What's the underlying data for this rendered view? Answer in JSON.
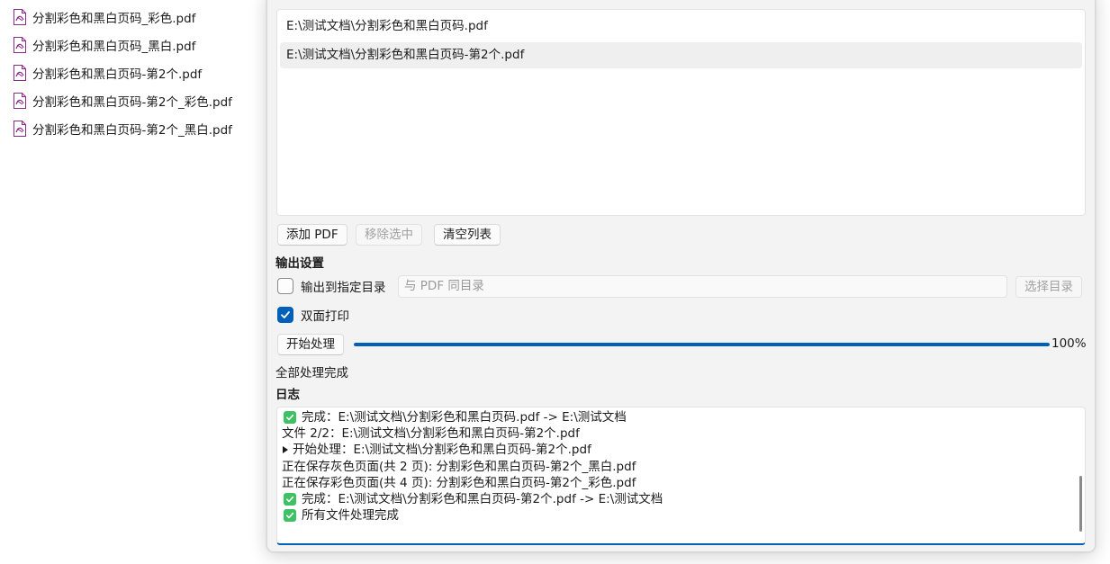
{
  "desktop_files": [
    {
      "name": "分割彩色和黑白页码_彩色.pdf",
      "icon": "pdf-file-icon"
    },
    {
      "name": "分割彩色和黑白页码_黑白.pdf",
      "icon": "pdf-file-icon"
    },
    {
      "name": "分割彩色和黑白页码-第2个.pdf",
      "icon": "pdf-file-icon"
    },
    {
      "name": "分割彩色和黑白页码-第2个_彩色.pdf",
      "icon": "pdf-file-icon"
    },
    {
      "name": "分割彩色和黑白页码-第2个_黑白.pdf",
      "icon": "pdf-file-icon"
    }
  ],
  "pdf_list": {
    "items": [
      {
        "path": "E:\\测试文档\\分割彩色和黑白页码.pdf",
        "selected": false
      },
      {
        "path": "E:\\测试文档\\分割彩色和黑白页码-第2个.pdf",
        "selected": true
      }
    ]
  },
  "list_buttons": {
    "add": "添加 PDF",
    "remove": "移除选中",
    "clear": "清空列表"
  },
  "output_settings": {
    "title": "输出设置",
    "custom_dir_label": "输出到指定目录",
    "custom_dir_checked": false,
    "dir_placeholder": "与 PDF 同目录",
    "choose_dir": "选择目录",
    "duplex_label": "双面打印",
    "duplex_checked": true
  },
  "process": {
    "start": "开始处理",
    "progress_value": 1.0,
    "progress_text": "100%",
    "status": "全部处理完成"
  },
  "log": {
    "title": "日志",
    "lines": [
      {
        "icon": "check-mark-icon",
        "text": "完成：E:\\测试文档\\分割彩色和黑白页码.pdf -> E:\\测试文档"
      },
      {
        "icon": "",
        "text": "文件 2/2：E:\\测试文档\\分割彩色和黑白页码-第2个.pdf"
      },
      {
        "icon": "play-triangle-icon",
        "text": "开始处理：E:\\测试文档\\分割彩色和黑白页码-第2个.pdf"
      },
      {
        "icon": "",
        "text": "正在保存灰色页面(共 2 页): 分割彩色和黑白页码-第2个_黑白.pdf"
      },
      {
        "icon": "",
        "text": "正在保存彩色页面(共 4 页): 分割彩色和黑白页码-第2个_彩色.pdf"
      },
      {
        "icon": "check-mark-icon",
        "text": "完成：E:\\测试文档\\分割彩色和黑白页码-第2个.pdf -> E:\\测试文档"
      },
      {
        "icon": "check-mark-icon",
        "text": "所有文件处理完成"
      }
    ]
  },
  "colors": {
    "accent": "#005fb8",
    "success_check": "#3ec065",
    "pdf_icon": "#8b2a8b"
  }
}
